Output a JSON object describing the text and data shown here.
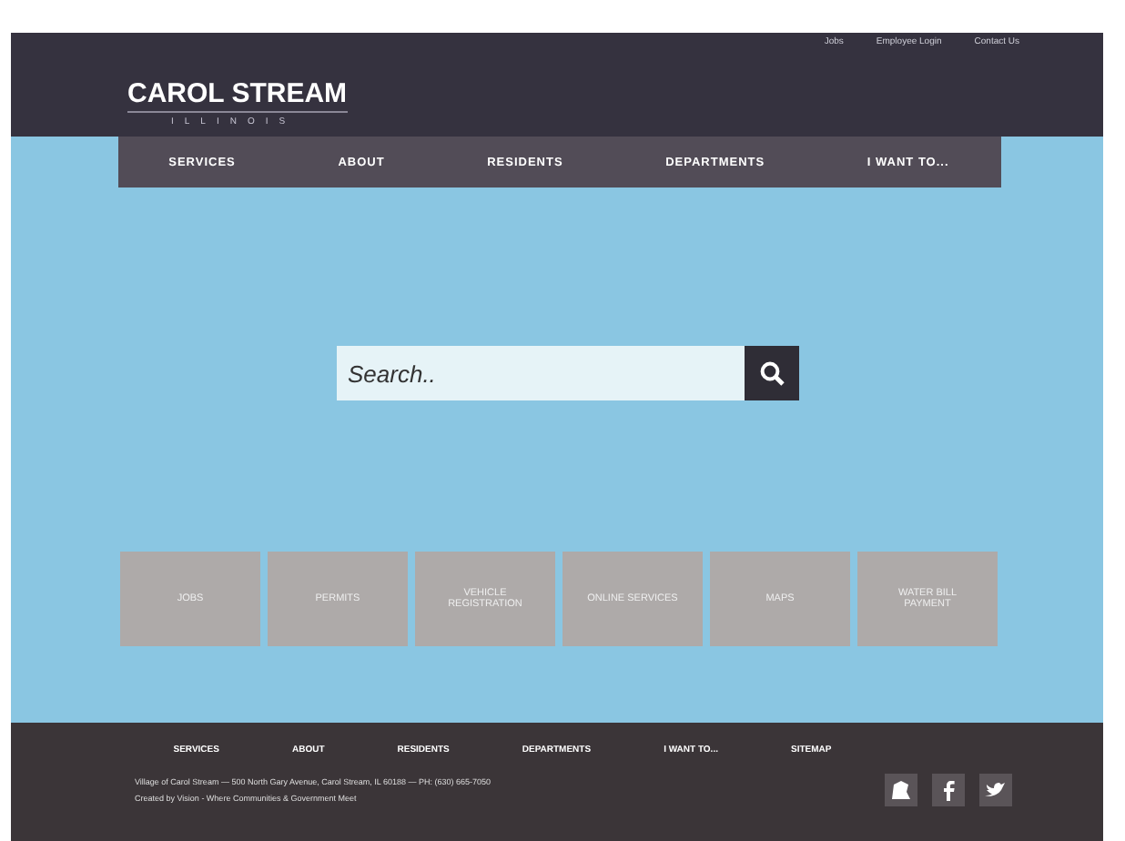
{
  "utility_links": [
    "Jobs",
    "Employee Login",
    "Contact Us"
  ],
  "logo": {
    "name": "CAROL STREAM",
    "state": "ILLINOIS"
  },
  "nav": [
    "SERVICES",
    "ABOUT",
    "RESIDENTS",
    "DEPARTMENTS",
    "I WANT TO..."
  ],
  "search": {
    "placeholder": "Search.."
  },
  "tiles": [
    "JOBS",
    "PERMITS",
    "VEHICLE REGISTRATION",
    "ONLINE SERVICES",
    "MAPS",
    "WATER BILL PAYMENT"
  ],
  "footer": {
    "links": [
      "SERVICES",
      "ABOUT",
      "RESIDENTS",
      "DEPARTMENTS",
      "I WANT TO...",
      "SITEMAP"
    ],
    "address": "Village of Carol Stream — 500 North Gary Avenue, Carol Stream, IL 60188 — PH: (630) 665-7050",
    "credit": "Created by Vision - Where Communities & Government Meet"
  }
}
